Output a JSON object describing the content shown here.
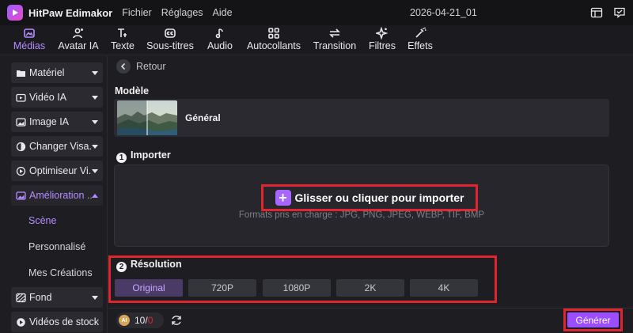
{
  "app": {
    "name": "HitPaw Edimakor",
    "menu": [
      "Fichier",
      "Réglages",
      "Aide"
    ],
    "project_title": "2026-04-21_01"
  },
  "toolbar": {
    "tabs": [
      {
        "label": "Médias",
        "icon": "media-icon",
        "active": true
      },
      {
        "label": "Avatar IA",
        "icon": "avatar-icon"
      },
      {
        "label": "Texte",
        "icon": "text-icon"
      },
      {
        "label": "Sous-titres",
        "icon": "subtitles-icon"
      },
      {
        "label": "Audio",
        "icon": "audio-icon"
      },
      {
        "label": "Autocollants",
        "icon": "stickers-icon"
      },
      {
        "label": "Transition",
        "icon": "transition-icon"
      },
      {
        "label": "Filtres",
        "icon": "filters-icon"
      },
      {
        "label": "Effets",
        "icon": "effects-icon"
      }
    ]
  },
  "sidebar": {
    "items": [
      {
        "label": "Matériel",
        "icon": "folder-icon"
      },
      {
        "label": "Vidéo IA",
        "icon": "video-ai-icon"
      },
      {
        "label": "Image IA",
        "icon": "image-ai-icon"
      },
      {
        "label": "Changer Visa...",
        "icon": "face-swap-icon"
      },
      {
        "label": "Optimiseur Vi...",
        "icon": "optimizer-icon"
      },
      {
        "label": "Amélioration ...",
        "icon": "enhance-icon",
        "expanded": true
      },
      {
        "label": "Fond",
        "icon": "background-icon"
      },
      {
        "label": "Vidéos de stock",
        "icon": "stock-video-icon"
      }
    ],
    "subitems": [
      {
        "label": "Scène",
        "active": true
      },
      {
        "label": "Personnalisé"
      },
      {
        "label": "Mes Créations"
      }
    ]
  },
  "main": {
    "back_label": "Retour",
    "model_title": "Modèle",
    "model_name": "Général",
    "step1_number": "1",
    "step1_title": "Importer",
    "import_label": "Glisser ou cliquer pour importer",
    "formats_text": "Formats pris en charge : JPG, PNG, JPEG, WEBP, TIF, BMP",
    "step2_number": "2",
    "step2_title": "Résolution",
    "resolutions": [
      {
        "label": "Original",
        "active": true
      },
      {
        "label": "720P"
      },
      {
        "label": "1080P"
      },
      {
        "label": "2K"
      },
      {
        "label": "4K"
      }
    ]
  },
  "bottom": {
    "credits_remaining": "10",
    "credits_separator": "/",
    "credits_used": "0",
    "generate_label": "Générer"
  },
  "colors": {
    "accent": "#a070ff",
    "highlight_frame": "#e0252e",
    "generate_button": "#9b4dff"
  }
}
